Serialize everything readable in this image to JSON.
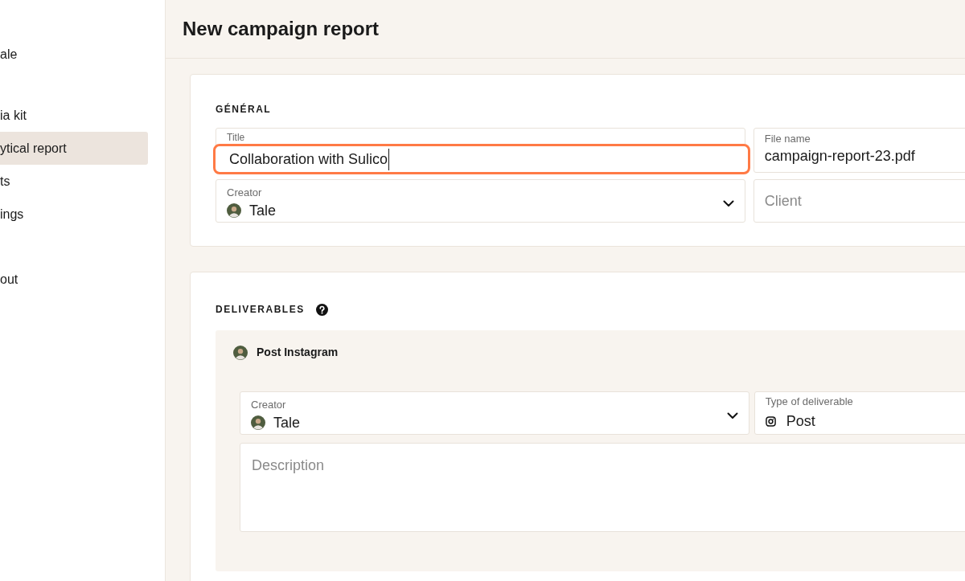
{
  "sidebar": {
    "items": [
      {
        "label": "ale",
        "selected": false
      },
      {
        "label": "ia kit",
        "selected": false
      },
      {
        "label": "ytical report",
        "selected": true
      },
      {
        "label": "ts",
        "selected": false
      },
      {
        "label": "ings",
        "selected": false
      },
      {
        "label": "out",
        "selected": false
      }
    ]
  },
  "page_title": "New campaign report",
  "general": {
    "heading": "GÉNÉRAL",
    "title_field": {
      "label": "Title",
      "value": "Collaboration with Sulico",
      "focused": true
    },
    "file_name_field": {
      "label": "File name",
      "value": "campaign-report-23.pdf"
    },
    "creator_field": {
      "label": "Creator",
      "value": "Tale"
    },
    "client_field": {
      "placeholder": "Client"
    }
  },
  "deliverables": {
    "heading": "DELIVERABLES",
    "item": {
      "title": "Post Instagram",
      "creator_field": {
        "label": "Creator",
        "value": "Tale"
      },
      "type_field": {
        "label": "Type of deliverable",
        "value": "Post"
      },
      "description_field": {
        "placeholder": "Description"
      }
    }
  }
}
